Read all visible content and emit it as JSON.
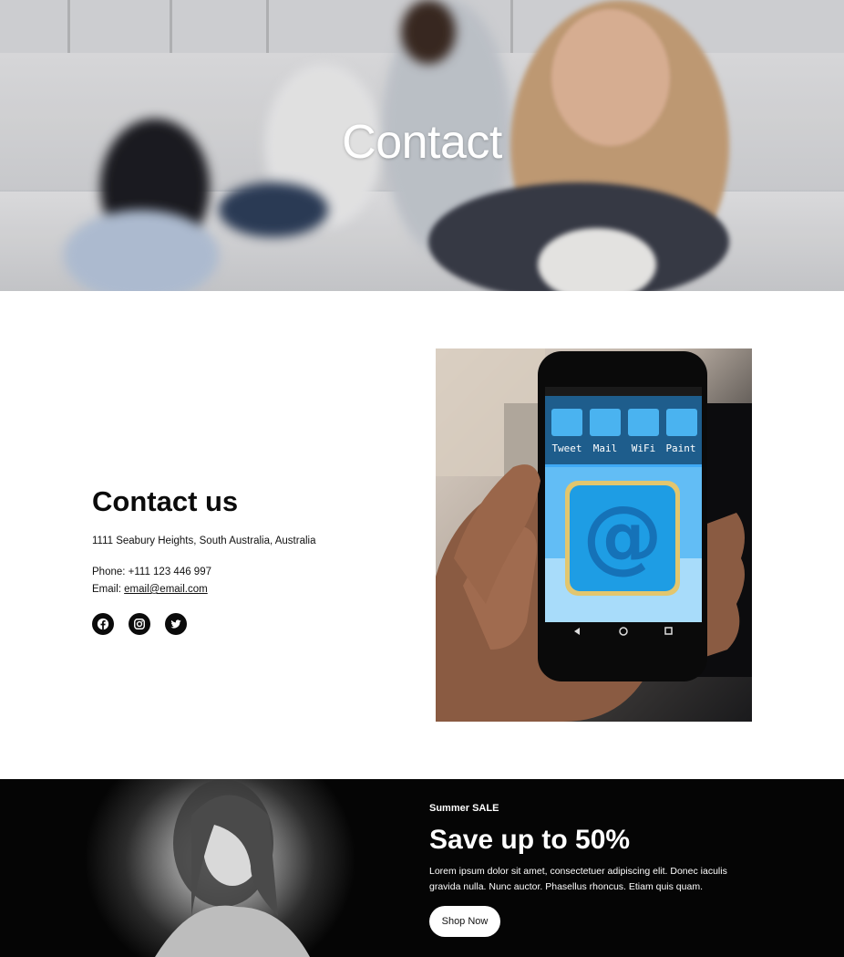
{
  "hero": {
    "title": "Contact"
  },
  "contact": {
    "heading": "Contact us",
    "address": "1111 Seabury Heights, South Australia, Australia",
    "phone": "Phone: +111 123 446 997",
    "email_label": "Email: ",
    "email_value": "email@email.com",
    "social": [
      {
        "icon": "facebook-icon"
      },
      {
        "icon": "instagram-icon"
      },
      {
        "icon": "twitter-icon"
      }
    ]
  },
  "phone_image": {
    "app_labels": [
      "Tweet",
      "Mail",
      "WiFi",
      "Paint"
    ],
    "screen_symbol": "@"
  },
  "promo": {
    "kicker": "Summer SALE",
    "title": "Save up to 50%",
    "body": "Lorem ipsum dolor sit amet, consectetuer adipiscing elit. Donec iaculis gravida nulla. Nunc auctor. Phasellus rhoncus. Etiam quis quam.",
    "button": "Shop Now"
  },
  "colors": {
    "promo_background": "#050505",
    "social_icon_background": "#0b0b0b",
    "phone_screen": "#3fa9f5"
  }
}
